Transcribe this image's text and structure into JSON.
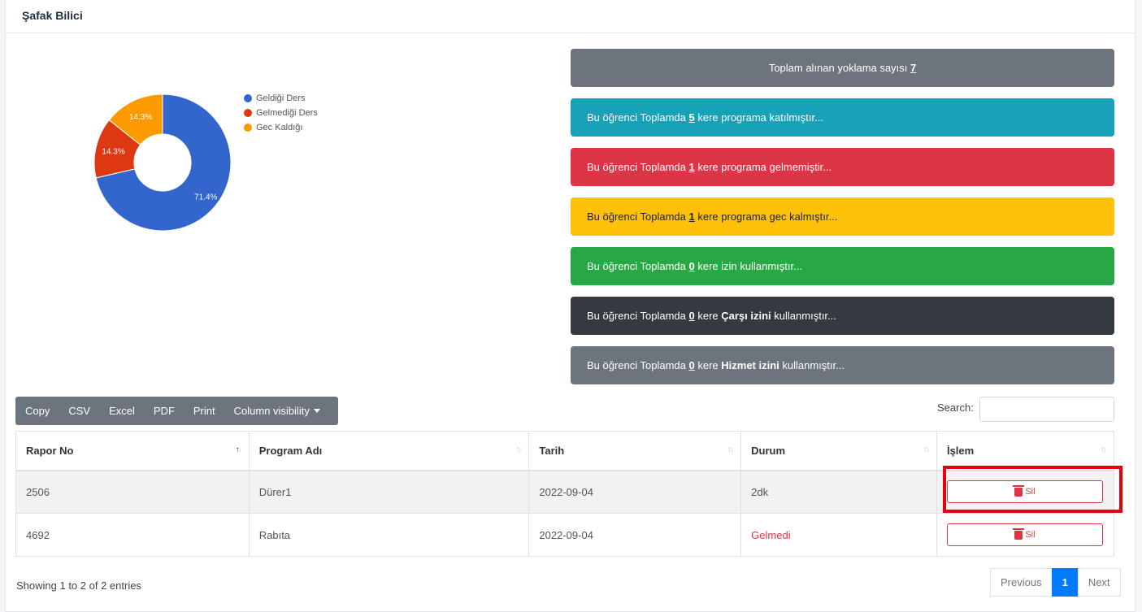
{
  "header": {
    "title": "Şafak Bilici"
  },
  "chart_data": {
    "type": "pie",
    "categories": [
      "Geldiği Ders",
      "Gelmediği Ders",
      "Gec Kaldığı"
    ],
    "values": [
      71.4,
      14.3,
      14.3
    ],
    "labels": [
      "71.4%",
      "14.3%",
      "14.3%"
    ],
    "colors": [
      "#3366cc",
      "#dc3912",
      "#ff9900"
    ],
    "legend_position": "right"
  },
  "alerts": {
    "total": {
      "prefix": "Toplam alınan yoklama sayısı ",
      "value": "7",
      "color": "#6c757d"
    },
    "attended": {
      "prefix": "Bu öğrenci Toplamda ",
      "value": "5",
      "suffix": " kere programa katılmıştır...",
      "color": "#17a2b8"
    },
    "absent": {
      "prefix": "Bu öğrenci Toplamda ",
      "value": "1",
      "suffix": " kere programa gelmemiştir...",
      "color": "#dc3545"
    },
    "late": {
      "prefix": "Bu öğrenci Toplamda ",
      "value": "1",
      "suffix": " kere programa gec kalmıştır...",
      "color": "#ffc107"
    },
    "leave": {
      "prefix": "Bu öğrenci Toplamda ",
      "value": "0",
      "suffix": " kere izin kullanmıştır...",
      "color": "#28a745"
    },
    "market_leave": {
      "prefix": "Bu öğrenci Toplamda ",
      "value": "0",
      "mid": " kere ",
      "bold": "Çarşı izini",
      "suffix": " kullanmıştır...",
      "color": "#343a40"
    },
    "service_leave": {
      "prefix": "Bu öğrenci Toplamda ",
      "value": "0",
      "mid": " kere ",
      "bold": "Hizmet izini",
      "suffix": " kullanmıştır...",
      "color": "#6c757d"
    }
  },
  "toolbar": {
    "copy": "Copy",
    "csv": "CSV",
    "excel": "Excel",
    "pdf": "PDF",
    "print": "Print",
    "colvis": "Column visibility"
  },
  "search": {
    "label": "Search:",
    "value": ""
  },
  "table": {
    "headers": [
      "Rapor No",
      "Program Adı",
      "Tarih",
      "Durum",
      "İşlem"
    ],
    "rows": [
      {
        "rapor_no": "2506",
        "program": "Dürer1",
        "tarih": "2022-09-04",
        "durum": "2dk",
        "action": "Sil"
      },
      {
        "rapor_no": "4692",
        "program": "Rabıta",
        "tarih": "2022-09-04",
        "durum": "Gelmedi",
        "action": "Sil"
      }
    ]
  },
  "footer": {
    "info": "Showing 1 to 2 of 2 entries",
    "prev": "Previous",
    "page": "1",
    "next": "Next"
  }
}
